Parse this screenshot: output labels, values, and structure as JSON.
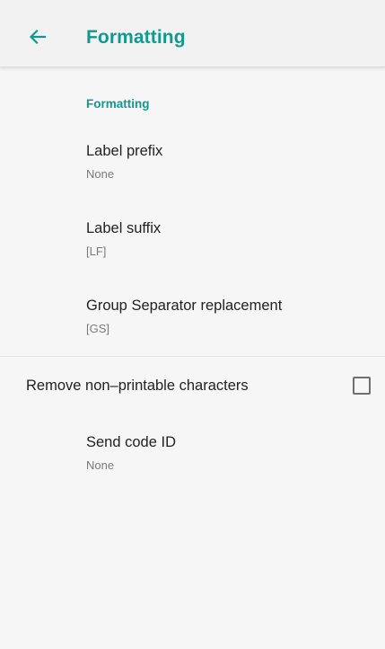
{
  "app_bar": {
    "title": "Formatting",
    "back_icon": "arrow-left-icon"
  },
  "section": {
    "header": "Formatting"
  },
  "preferences": [
    {
      "title": "Label prefix",
      "summary": "None"
    },
    {
      "title": "Label suffix",
      "summary": "[LF]"
    },
    {
      "title": "Group Separator replacement",
      "summary": "[GS]"
    }
  ],
  "checkbox_pref": {
    "label": "Remove non–printable characters",
    "checked": false
  },
  "send_code_id": {
    "title": "Send code ID",
    "summary": "None"
  },
  "colors": {
    "accent": "#11998f",
    "background": "#f6f6f6",
    "text_primary": "#222222",
    "text_secondary": "#7a7a7a"
  }
}
